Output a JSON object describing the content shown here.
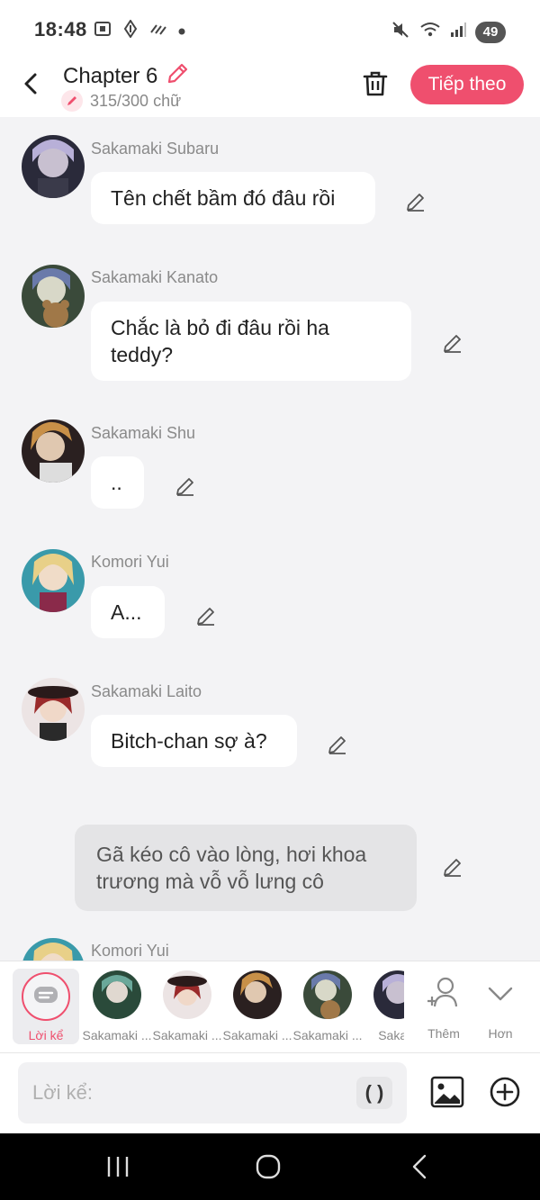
{
  "status_bar": {
    "time": "18:48",
    "battery": "49"
  },
  "header": {
    "title": "Chapter 6",
    "word_count": "315/300 chữ",
    "next_label": "Tiếp theo"
  },
  "messages": [
    {
      "sender": "Sakamaki Subaru",
      "text": "Tên chết bầm đó đâu rồi",
      "avatar_color": "#6a6a8a"
    },
    {
      "sender": "Sakamaki Kanato",
      "text": "Chắc là bỏ đi đâu rồi ha teddy?",
      "avatar_color": "#4a5a4a"
    },
    {
      "sender": "Sakamaki Shu",
      "text": "..",
      "avatar_color": "#7a5a4a"
    },
    {
      "sender": "Komori Yui",
      "text": "A...",
      "avatar_color": "#c9a860"
    },
    {
      "sender": "Sakamaki Laito",
      "text": "Bitch-chan sợ à?",
      "avatar_color": "#7a2a3a"
    }
  ],
  "narration": {
    "text": "Gã kéo cô vào lòng, hơi khoa trương mà vỗ vỗ lưng cô"
  },
  "partial_message": {
    "sender": "Komori Yui"
  },
  "character_strip": {
    "narrator_label": "Lời kể",
    "characters": [
      {
        "name": "Sakamaki ...",
        "avatar_color": "#3a6a5a"
      },
      {
        "name": "Sakamaki ...",
        "avatar_color": "#7a2a3a"
      },
      {
        "name": "Sakamaki ...",
        "avatar_color": "#7a5a4a"
      },
      {
        "name": "Sakamaki ...",
        "avatar_color": "#4a5a6a"
      },
      {
        "name": "Sakam",
        "avatar_color": "#5a5a7a"
      }
    ],
    "add_label": "Thêm",
    "more_label": "Hơn"
  },
  "input_bar": {
    "placeholder": "Lời kể:",
    "paren_label": "( )"
  },
  "colors": {
    "accent": "#ef4f6e",
    "background": "#f3f3f5",
    "bubble": "#ffffff",
    "narration_bubble": "#e4e4e6"
  }
}
